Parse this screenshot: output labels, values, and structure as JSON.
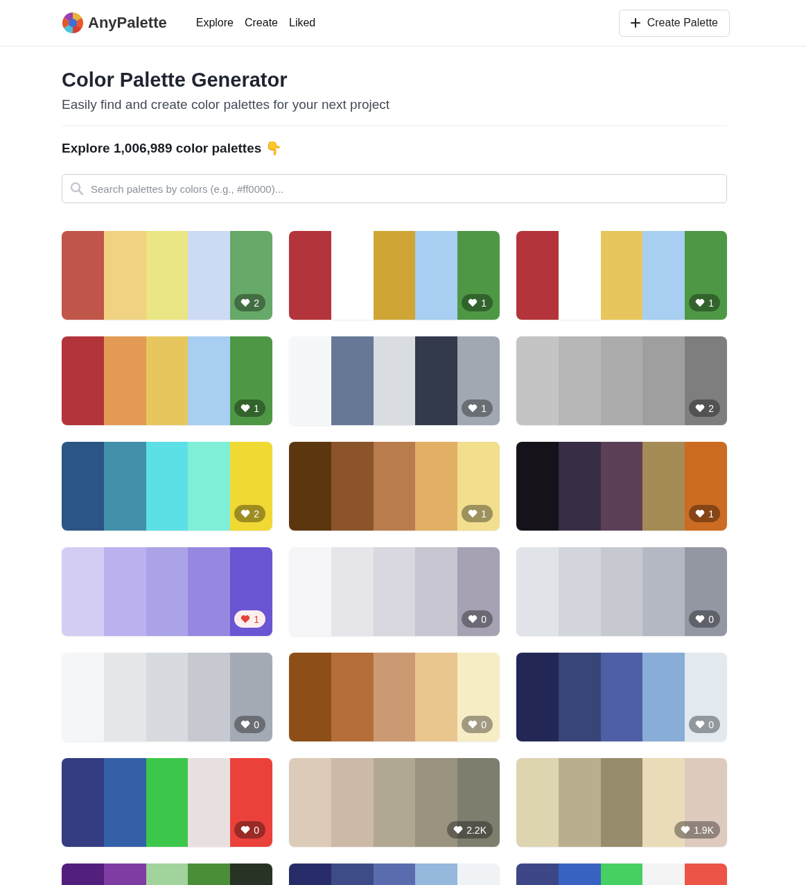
{
  "header": {
    "brand": "AnyPalette",
    "nav": [
      {
        "label": "Explore"
      },
      {
        "label": "Create"
      },
      {
        "label": "Liked"
      }
    ],
    "create_button": "Create Palette"
  },
  "title": "Color Palette Generator",
  "subtitle": "Easily find and create color palettes for your next project",
  "explore_heading": "Explore 1,006,989 color palettes 👇",
  "search": {
    "placeholder": "Search palettes by colors (e.g., #ff0000)..."
  },
  "palettes": [
    {
      "swatches": [
        {
          "color": "#c0564a"
        },
        {
          "color": "#f0d281"
        },
        {
          "color": "#eae683"
        },
        {
          "color": "#cddaf4"
        },
        {
          "color": "#67a968"
        }
      ],
      "likes": "2",
      "liked": false
    },
    {
      "swatches": [
        {
          "color": "#b3343a"
        },
        {
          "color": "#ffffff"
        },
        {
          "color": "#cfa535"
        },
        {
          "color": "#a8cef2"
        },
        {
          "color": "#4e9845"
        }
      ],
      "likes": "1",
      "liked": false
    },
    {
      "swatches": [
        {
          "color": "#b3343a"
        },
        {
          "color": "#ffffff"
        },
        {
          "color": "#e7c75d"
        },
        {
          "color": "#a8cef2"
        },
        {
          "color": "#4e9845"
        }
      ],
      "likes": "1",
      "liked": false
    },
    {
      "swatches": [
        {
          "color": "#b3343a"
        },
        {
          "color": "#e29a55"
        },
        {
          "color": "#e7c75d"
        },
        {
          "color": "#a8cef2"
        },
        {
          "color": "#4e9845"
        }
      ],
      "likes": "1",
      "liked": false
    },
    {
      "swatches": [
        {
          "color": "#f6f7f9"
        },
        {
          "color": "#677896"
        },
        {
          "color": "#d9dce1"
        },
        {
          "color": "#323a4b"
        },
        {
          "color": "#a2a8b2"
        }
      ],
      "likes": "1",
      "liked": false
    },
    {
      "swatches": [
        {
          "color": "#c4c4c4"
        },
        {
          "color": "#b7b7b7"
        },
        {
          "color": "#acacac"
        },
        {
          "color": "#9f9f9f"
        },
        {
          "color": "#7e7e7e"
        }
      ],
      "likes": "2",
      "liked": false
    },
    {
      "swatches": [
        {
          "color": "#2b5585"
        },
        {
          "color": "#4390aa"
        },
        {
          "color": "#5ce0e6"
        },
        {
          "color": "#80efd7"
        },
        {
          "color": "#f1d934"
        }
      ],
      "likes": "2",
      "liked": false
    },
    {
      "swatches": [
        {
          "color": "#5c360f"
        },
        {
          "color": "#8b542b"
        },
        {
          "color": "#b97c4d"
        },
        {
          "color": "#e2b065"
        },
        {
          "color": "#f1df8e"
        }
      ],
      "likes": "1",
      "liked": false
    },
    {
      "swatches": [
        {
          "color": "#15121a"
        },
        {
          "color": "#372d45"
        },
        {
          "color": "#5d3f57"
        },
        {
          "color": "#a58b55"
        },
        {
          "color": "#cc6b22"
        }
      ],
      "likes": "1",
      "liked": false
    },
    {
      "swatches": [
        {
          "color": "#d3cdf3"
        },
        {
          "color": "#bbb1ef"
        },
        {
          "color": "#aba3e8"
        },
        {
          "color": "#9687e0"
        },
        {
          "color": "#6a55d3"
        }
      ],
      "likes": "1",
      "liked": true
    },
    {
      "swatches": [
        {
          "color": "#f6f6f8"
        },
        {
          "color": "#e6e5ea"
        },
        {
          "color": "#d9d7df"
        },
        {
          "color": "#c7c5d0"
        },
        {
          "color": "#a6a2b4"
        }
      ],
      "likes": "0",
      "liked": false
    },
    {
      "swatches": [
        {
          "color": "#e0e3e8"
        },
        {
          "color": "#d2d5dc"
        },
        {
          "color": "#c6c9d0"
        },
        {
          "color": "#b4b8c2"
        },
        {
          "color": "#9297a2"
        }
      ],
      "likes": "0",
      "liked": false
    },
    {
      "swatches": [
        {
          "color": "#f5f6f8"
        },
        {
          "color": "#e4e6e8"
        },
        {
          "color": "#d7dbdf"
        },
        {
          "color": "#c6c9cf"
        },
        {
          "color": "#a4aab3"
        }
      ],
      "likes": "0",
      "liked": false
    },
    {
      "swatches": [
        {
          "color": "#8d4f17"
        },
        {
          "color": "#b56e38"
        },
        {
          "color": "#cb9a73"
        },
        {
          "color": "#eac68f"
        },
        {
          "color": "#f7edc5"
        }
      ],
      "likes": "0",
      "liked": false
    },
    {
      "swatches": [
        {
          "color": "#232756"
        },
        {
          "color": "#384577"
        },
        {
          "color": "#4f5fa6"
        },
        {
          "color": "#88add6"
        },
        {
          "color": "#e2eaf0"
        }
      ],
      "likes": "0",
      "liked": false
    },
    {
      "swatches": [
        {
          "color": "#343c82"
        },
        {
          "color": "#3460a7"
        },
        {
          "color": "#3dc74a"
        },
        {
          "color": "#e8e0df"
        },
        {
          "color": "#eb413b"
        }
      ],
      "likes": "0",
      "liked": false
    },
    {
      "swatches": [
        {
          "color": "#dccbb8"
        },
        {
          "color": "#cdb9a7"
        },
        {
          "color": "#b1a892"
        },
        {
          "color": "#9a937f"
        },
        {
          "color": "#7e7e6f"
        }
      ],
      "likes": "2.2K",
      "liked": false
    },
    {
      "swatches": [
        {
          "color": "#ddd5b0"
        },
        {
          "color": "#b9ae8e"
        },
        {
          "color": "#978c6c"
        },
        {
          "color": "#eadcb8"
        },
        {
          "color": "#decabe"
        }
      ],
      "likes": "1.9K",
      "liked": false
    },
    {
      "swatches": [
        {
          "color": "#521f7c"
        },
        {
          "color": "#7f3ca2"
        },
        {
          "color": "#a3d39c"
        },
        {
          "color": "#4a8e39"
        },
        {
          "color": "#283225"
        }
      ]
    },
    {
      "swatches": [
        {
          "color": "#272c68"
        },
        {
          "color": "#3d4c86"
        },
        {
          "color": "#5a6cad"
        },
        {
          "color": "#95b8dc"
        },
        {
          "color": "#f0f3f6"
        }
      ]
    },
    {
      "swatches": [
        {
          "color": "#3d4687"
        },
        {
          "color": "#3863c3"
        },
        {
          "color": "#46d063"
        },
        {
          "color": "#f4f4f4"
        },
        {
          "color": "#ed5448"
        }
      ]
    }
  ]
}
